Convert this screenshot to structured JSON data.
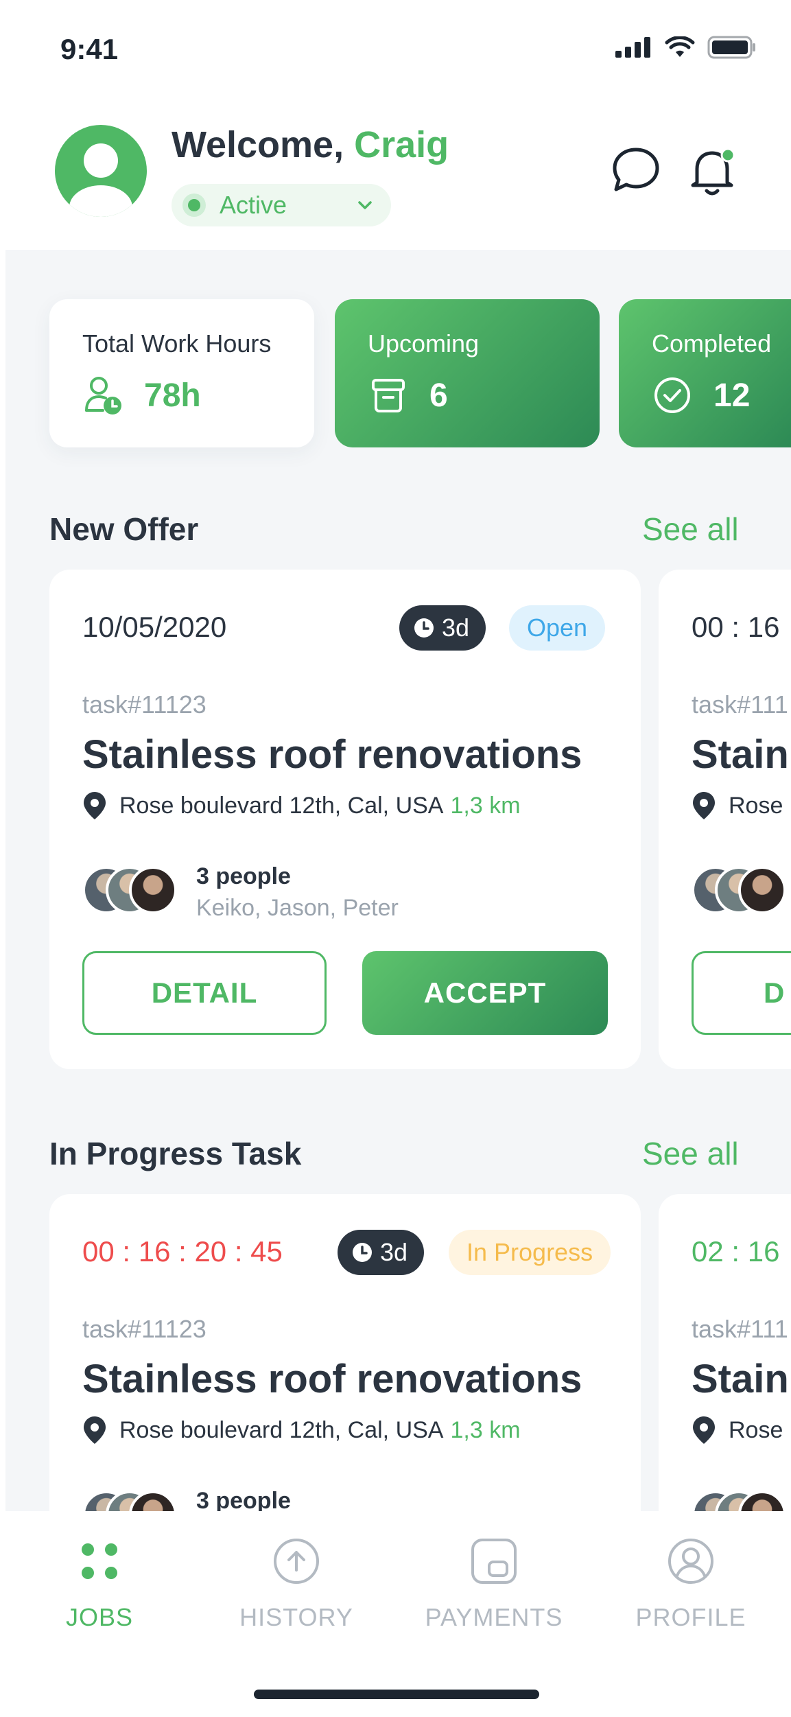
{
  "status_bar": {
    "time": "9:41"
  },
  "header": {
    "welcome_prefix": "Welcome, ",
    "user_name": "Craig",
    "status": "Active"
  },
  "stats": [
    {
      "label": "Total Work Hours",
      "value": "78h",
      "icon": "user-clock-icon"
    },
    {
      "label": "Upcoming",
      "value": "6",
      "icon": "archive-box-icon"
    },
    {
      "label": "Completed",
      "value": "12",
      "icon": "check-circle-icon"
    }
  ],
  "new_offer": {
    "title": "New Offer",
    "see_all": "See all",
    "cards": [
      {
        "date": "10/05/2020",
        "duration": "3d",
        "status": "Open",
        "task_id": "task#11123",
        "title": "Stainless roof renovations",
        "address": "Rose boulevard 12th, Cal, USA",
        "distance": "1,3 km",
        "people_count": "3 people",
        "people_names": "Keiko,  Jason, Peter",
        "detail_label": "DETAIL",
        "accept_label": "ACCEPT"
      },
      {
        "date": "00 : 16",
        "task_id": "task#111",
        "title": "Stain",
        "address": "Rose",
        "detail_label": "D"
      }
    ]
  },
  "in_progress": {
    "title": "In Progress Task",
    "see_all": "See all",
    "cards": [
      {
        "timer": "00 : 16 : 20 : 45",
        "duration": "3d",
        "status": "In Progress",
        "task_id": "task#11123",
        "title": "Stainless roof renovations",
        "address": "Rose boulevard 12th, Cal, USA",
        "distance": "1,3 km",
        "people_count": "3 people"
      },
      {
        "timer": "02 : 16",
        "task_id": "task#111",
        "title": "Stain",
        "address": "Rose"
      }
    ]
  },
  "tabs": [
    {
      "label": "JOBS",
      "icon": "grid-dots-icon",
      "active": true
    },
    {
      "label": "HISTORY",
      "icon": "upload-circle-icon",
      "active": false
    },
    {
      "label": "PAYMENTS",
      "icon": "wallet-icon",
      "active": false
    },
    {
      "label": "PROFILE",
      "icon": "profile-circle-icon",
      "active": false
    }
  ],
  "colors": {
    "accent": "#4fb865",
    "accent_dark": "#2d8a55",
    "danger": "#ee4c4c",
    "info": "#3ea7e8",
    "warning": "#f5bb4c",
    "text": "#2b3440",
    "muted": "#9aa3ad"
  }
}
